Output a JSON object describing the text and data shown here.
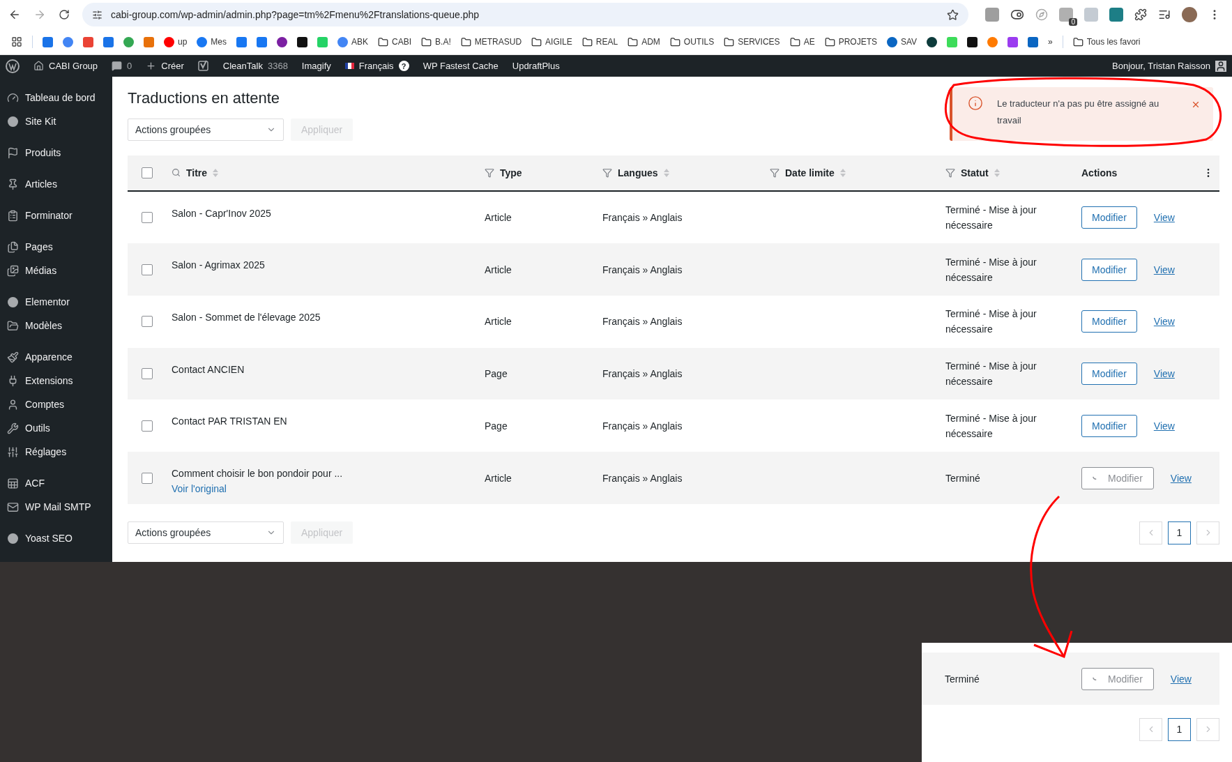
{
  "browser": {
    "url": "cabi-group.com/wp-admin/admin.php?page=tm%2Fmenu%2Ftranslations-queue.php",
    "extension_badge": "0"
  },
  "bookmarks": [
    {
      "kind": "site"
    },
    {
      "kind": "site"
    },
    {
      "kind": "site"
    },
    {
      "kind": "site"
    },
    {
      "kind": "site"
    },
    {
      "kind": "site"
    },
    {
      "kind": "site",
      "label": "up"
    },
    {
      "kind": "site",
      "label": "Mes"
    },
    {
      "kind": "site"
    },
    {
      "kind": "site"
    },
    {
      "kind": "site"
    },
    {
      "kind": "site"
    },
    {
      "kind": "site"
    },
    {
      "kind": "site",
      "label": "ABK"
    },
    {
      "kind": "folder",
      "label": "CABI"
    },
    {
      "kind": "folder",
      "label": "B.A!"
    },
    {
      "kind": "folder",
      "label": "METRASUD"
    },
    {
      "kind": "folder",
      "label": "AIGILE"
    },
    {
      "kind": "folder",
      "label": "REAL"
    },
    {
      "kind": "folder",
      "label": "ADM"
    },
    {
      "kind": "folder",
      "label": "OUTILS"
    },
    {
      "kind": "folder",
      "label": "SERVICES"
    },
    {
      "kind": "folder",
      "label": "AE"
    },
    {
      "kind": "folder",
      "label": "PROJETS"
    },
    {
      "kind": "site",
      "label": "SAV"
    },
    {
      "kind": "site"
    },
    {
      "kind": "site"
    },
    {
      "kind": "site"
    },
    {
      "kind": "site"
    },
    {
      "kind": "site"
    },
    {
      "kind": "site"
    }
  ],
  "bookmarks_overflow": "»",
  "all_bookmarks": "Tous les favori",
  "admin_bar": {
    "site": "CABI Group",
    "comments": "0",
    "new": "Créer",
    "items": [
      {
        "label": "CleanTalk",
        "count": "3368"
      },
      {
        "label": "Imagify"
      },
      {
        "label": "Français",
        "badge": "?"
      },
      {
        "label": "WP Fastest Cache"
      },
      {
        "label": "UpdraftPlus"
      }
    ],
    "greeting": "Bonjour, Tristan Raisson"
  },
  "sidebar": {
    "groups": [
      [
        "Tableau de bord",
        "Site Kit"
      ],
      [
        "Produits"
      ],
      [
        "Articles"
      ],
      [
        "Forminator"
      ],
      [
        "Pages",
        "Médias"
      ],
      [
        "Elementor",
        "Modèles"
      ],
      [
        "Apparence",
        "Extensions",
        "Comptes",
        "Outils",
        "Réglages"
      ],
      [
        "ACF",
        "WP Mail SMTP"
      ],
      [
        "Yoast SEO"
      ]
    ]
  },
  "page_title": "Traductions en attente",
  "bulk_actions": {
    "top": {
      "value": "Actions groupées",
      "apply": "Appliquer",
      "disabled": true
    },
    "bottom": {
      "value": "Actions groupées",
      "apply": "Appliquer",
      "disabled": true
    }
  },
  "notice": {
    "text": "Le traducteur n'a pas pu être assigné au travail"
  },
  "table": {
    "select_all": {
      "checked": false
    },
    "columns": [
      {
        "label": "Titre",
        "kind": "search",
        "sortable": true
      },
      {
        "label": "Type",
        "kind": "filter",
        "sortable": false
      },
      {
        "label": "Langues",
        "kind": "filter",
        "sortable": true
      },
      {
        "label": "Date limite",
        "kind": "filter",
        "sortable": true
      },
      {
        "label": "Statut",
        "kind": "filter",
        "sortable": true
      },
      {
        "label": "Actions",
        "kind": "plain",
        "sortable": false
      }
    ],
    "rows": [
      {
        "checked": false,
        "title": "Salon - Capr'Inov 2025",
        "type": "Article",
        "languages": "Français » Anglais",
        "status": "Terminé - Mise à jour nécessaire",
        "action": "Modifier",
        "loading": false,
        "link": "View"
      },
      {
        "checked": false,
        "title": "Salon - Agrimax 2025",
        "type": "Article",
        "languages": "Français » Anglais",
        "status": "Terminé - Mise à jour nécessaire",
        "action": "Modifier",
        "loading": false,
        "link": "View"
      },
      {
        "checked": false,
        "title": "Salon - Sommet de l'élevage 2025",
        "type": "Article",
        "languages": "Français » Anglais",
        "status": "Terminé - Mise à jour nécessaire",
        "action": "Modifier",
        "loading": false,
        "link": "View"
      },
      {
        "checked": false,
        "title": "Contact ANCIEN",
        "type": "Page",
        "languages": "Français » Anglais",
        "status": "Terminé - Mise à jour nécessaire",
        "action": "Modifier",
        "loading": false,
        "link": "View"
      },
      {
        "checked": false,
        "title": "Contact PAR TRISTAN EN",
        "type": "Page",
        "languages": "Français » Anglais",
        "status": "Terminé - Mise à jour nécessaire",
        "action": "Modifier",
        "loading": false,
        "link": "View"
      },
      {
        "checked": false,
        "title": "Comment choisir le bon pondoir pour ...",
        "original_link": "Voir l'original",
        "type": "Article",
        "languages": "Français » Anglais",
        "status": "Terminé",
        "action": "Modifier",
        "loading": true,
        "link": "View"
      }
    ]
  },
  "pagination": {
    "pages": [
      {
        "label": "1",
        "selected": true
      }
    ],
    "prev_disabled": true,
    "next_disabled": true
  },
  "inset": {
    "row": {
      "status": "Terminé",
      "action": "Modifier",
      "loading": true,
      "link": "View"
    },
    "pagination": {
      "pages": [
        {
          "label": "1",
          "selected": true
        }
      ],
      "prev_disabled": true,
      "next_disabled": true
    }
  }
}
